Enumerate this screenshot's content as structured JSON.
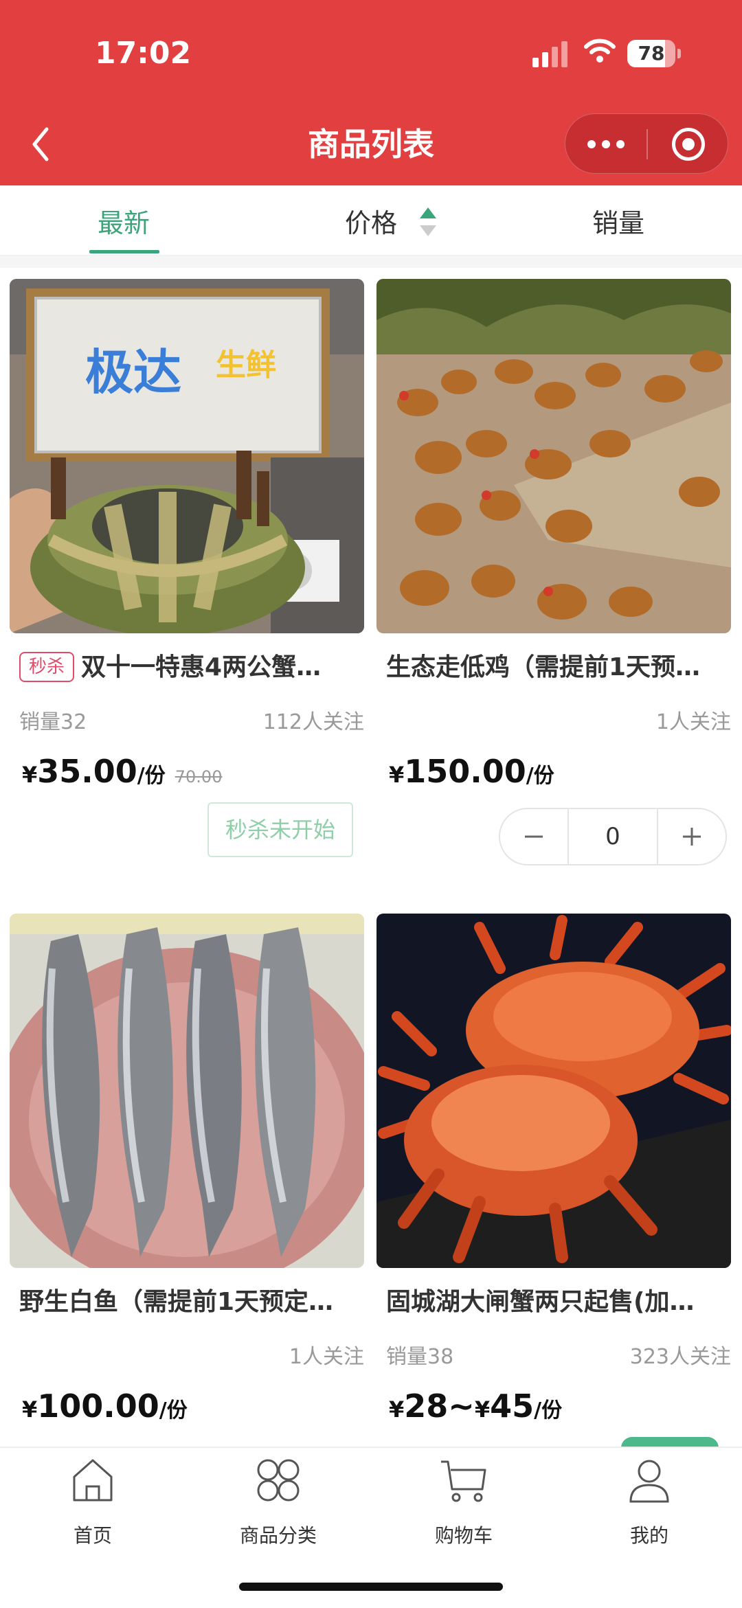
{
  "status_bar": {
    "time": "17:02",
    "battery": "78",
    "battery_fraction": 0.78
  },
  "nav": {
    "title": "商品列表"
  },
  "sort_tabs": [
    {
      "label": "最新"
    },
    {
      "label": "价格"
    },
    {
      "label": "销量"
    }
  ],
  "products": [
    {
      "tag": "秒杀",
      "title": "双十一特惠4两公蟹…",
      "sales": "销量32",
      "follow": "112人关注",
      "price_yen": "¥",
      "price": "35.00",
      "unit": "/份",
      "original_price": "70.00",
      "action": "秒杀未开始"
    },
    {
      "title": "生态走低鸡（需提前1天预…",
      "follow": "1人关注",
      "price_yen": "¥",
      "price": "150.00",
      "unit": "/份",
      "quantity": "0"
    },
    {
      "title": "野生白鱼（需提前1天预定…",
      "follow": "1人关注",
      "price_yen": "¥",
      "price": "100.00",
      "unit": "/份"
    },
    {
      "title": "固城湖大闸蟹两只起售(加…",
      "sales": "销量38",
      "follow": "323人关注",
      "price_yen": "¥",
      "price": "28~",
      "price_yen2": "¥",
      "price2": "45",
      "unit": "/份"
    }
  ],
  "tabbar": [
    {
      "label": "首页",
      "icon": "home-icon"
    },
    {
      "label": "商品分类",
      "icon": "category-icon"
    },
    {
      "label": "购物车",
      "icon": "cart-icon"
    },
    {
      "label": "我的",
      "icon": "user-icon"
    }
  ],
  "colors": {
    "header_red": "#e24040",
    "accent_green": "#3aa57a",
    "seckill_pink": "#e24a6a"
  }
}
